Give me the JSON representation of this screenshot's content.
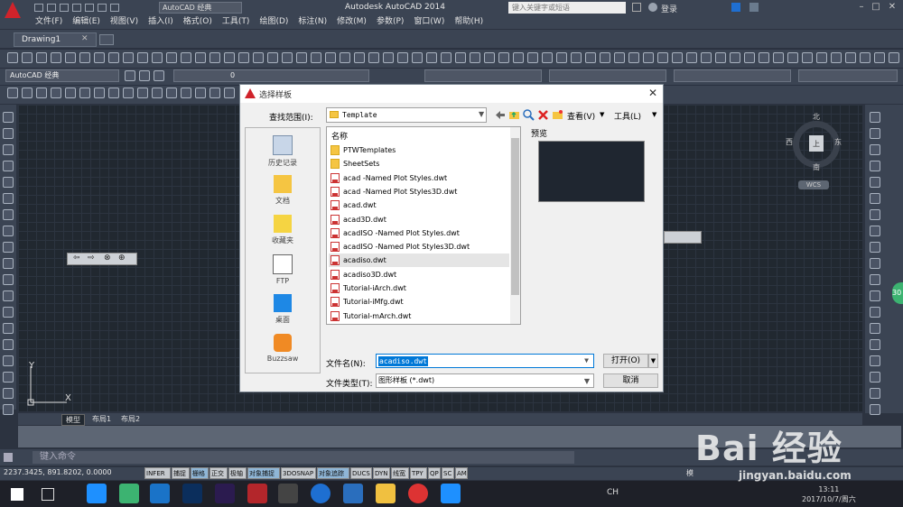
{
  "app": {
    "title": "Autodesk AutoCAD 2014",
    "workspace_combo": "AutoCAD 经典",
    "search_placeholder": "键入关键字或短语",
    "login": "登录"
  },
  "menu": [
    "文件(F)",
    "编辑(E)",
    "视图(V)",
    "插入(I)",
    "格式(O)",
    "工具(T)",
    "绘图(D)",
    "标注(N)",
    "修改(M)",
    "参数(P)",
    "窗口(W)",
    "帮助(H)"
  ],
  "document_tab": "Drawing1",
  "toolbar": {
    "workspace": "AutoCAD 经典",
    "layer_value": "0"
  },
  "compass": {
    "n": "北",
    "s": "南",
    "e": "东",
    "w": "西",
    "top": "上",
    "wcs": "WCS"
  },
  "layout_tabs": [
    "模型",
    "布局1",
    "布局2"
  ],
  "command": {
    "placeholder": "键入命令"
  },
  "status": {
    "coords": "2237.3425, 891.8202, 0.0000",
    "buttons": [
      {
        "label": "INFER",
        "on": false
      },
      {
        "label": "捕捉",
        "on": false
      },
      {
        "label": "栅格",
        "on": true
      },
      {
        "label": "正交",
        "on": false
      },
      {
        "label": "极轴",
        "on": false
      },
      {
        "label": "对象捕捉",
        "on": true
      },
      {
        "label": "3DOSNAP",
        "on": false
      },
      {
        "label": "对象追踪",
        "on": true
      },
      {
        "label": "DUCS",
        "on": false
      },
      {
        "label": "DYN",
        "on": false
      },
      {
        "label": "线宽",
        "on": false
      },
      {
        "label": "TPY",
        "on": false
      },
      {
        "label": "QP",
        "on": false
      },
      {
        "label": "SC",
        "on": false
      },
      {
        "label": "AM",
        "on": false
      }
    ],
    "model_label": "模"
  },
  "taskbar": {
    "ime": "CH",
    "time": "13:11",
    "date": "2017/10/7/周六"
  },
  "dialog": {
    "title": "选择样板",
    "lookin_label": "查找范围(I):",
    "lookin_value": "Template",
    "views_label": "查看(V)",
    "tools_label": "工具(L)",
    "places": [
      "历史记录",
      "文档",
      "收藏夹",
      "FTP",
      "桌面",
      "Buzzsaw"
    ],
    "column_name": "名称",
    "files": [
      {
        "name": "PTWTemplates",
        "type": "folder"
      },
      {
        "name": "SheetSets",
        "type": "folder"
      },
      {
        "name": "acad -Named Plot Styles.dwt",
        "type": "dwt"
      },
      {
        "name": "acad -Named Plot Styles3D.dwt",
        "type": "dwt"
      },
      {
        "name": "acad.dwt",
        "type": "dwt"
      },
      {
        "name": "acad3D.dwt",
        "type": "dwt"
      },
      {
        "name": "acadISO -Named Plot Styles.dwt",
        "type": "dwt"
      },
      {
        "name": "acadISO -Named Plot Styles3D.dwt",
        "type": "dwt"
      },
      {
        "name": "acadiso.dwt",
        "type": "dwt",
        "selected": true
      },
      {
        "name": "acadiso3D.dwt",
        "type": "dwt"
      },
      {
        "name": "Tutorial-iArch.dwt",
        "type": "dwt"
      },
      {
        "name": "Tutorial-iMfg.dwt",
        "type": "dwt"
      },
      {
        "name": "Tutorial-mArch.dwt",
        "type": "dwt"
      }
    ],
    "preview_label": "预览",
    "filename_label": "文件名(N):",
    "filename_value": "acadiso.dwt",
    "filetype_label": "文件类型(T):",
    "filetype_value": "图形样板 (*.dwt)",
    "open_button": "打开(O)",
    "cancel_button": "取消"
  },
  "watermark": {
    "text": "Bai 经验",
    "url": "jingyan.baidu.com"
  }
}
